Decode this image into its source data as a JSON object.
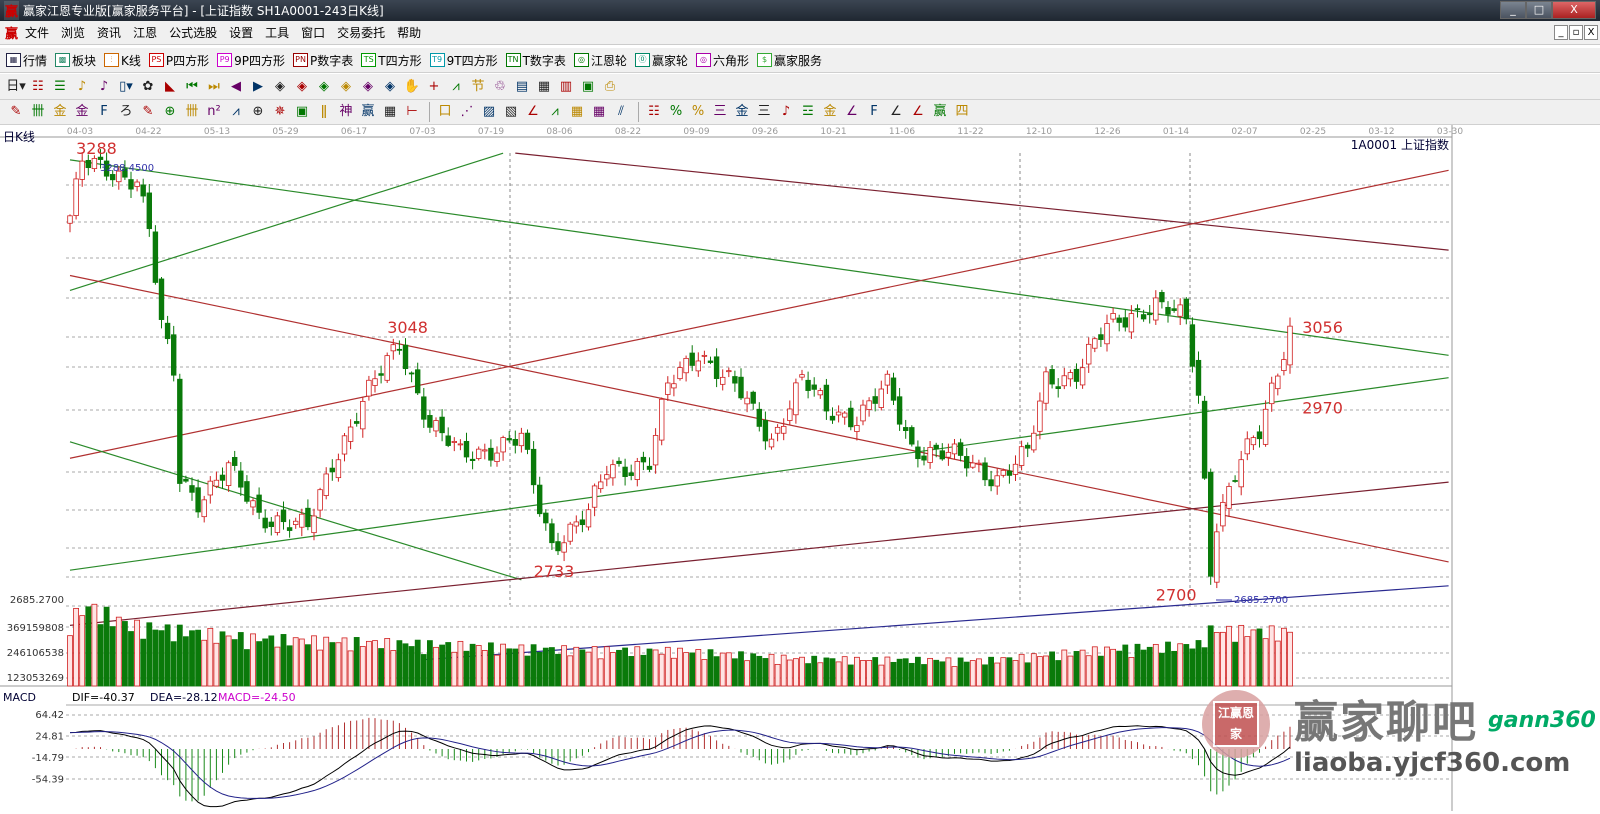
{
  "window": {
    "title": "赢家江恩专业版[赢家服务平台] - [上证指数  SH1A0001-243日K线]",
    "logo": "赢",
    "min": "_",
    "max": "□",
    "close": "X"
  },
  "menu": {
    "logo": "赢",
    "items": [
      "文件",
      "浏览",
      "资讯",
      "江恩",
      "公式选股",
      "设置",
      "工具",
      "窗口",
      "交易委托",
      "帮助"
    ],
    "mdi": [
      "_",
      "▫",
      "X"
    ]
  },
  "toolbar1": [
    {
      "icon": "▦",
      "label": "行情",
      "color": "#224"
    },
    {
      "icon": "▩",
      "label": "板块",
      "color": "#286"
    },
    {
      "icon": "⫶",
      "label": "K线",
      "color": "#c60"
    },
    {
      "icon": "PS",
      "label": "P四方形",
      "color": "#c00"
    },
    {
      "icon": "P9",
      "label": "9P四方形",
      "color": "#c0c"
    },
    {
      "icon": "PN",
      "label": "P数字表",
      "color": "#900"
    },
    {
      "icon": "TS",
      "label": "T四方形",
      "color": "#090"
    },
    {
      "icon": "T9",
      "label": "9T四方形",
      "color": "#09a"
    },
    {
      "icon": "TN",
      "label": "T数字表",
      "color": "#070"
    },
    {
      "icon": "◎",
      "label": "江恩轮",
      "color": "#070"
    },
    {
      "icon": "⓪",
      "label": "赢家轮",
      "color": "#086"
    },
    {
      "icon": "◎",
      "label": "六角形",
      "color": "#a0a"
    },
    {
      "icon": "$",
      "label": "赢家服务",
      "color": "#3a3"
    }
  ],
  "toolbar2": [
    "日▾",
    "☷",
    "☰",
    "♪",
    "♪",
    "▯▾",
    "✿",
    "◣",
    "⏮",
    "⏭",
    "◀",
    "▶",
    "◈",
    "◈",
    "◈",
    "◈",
    "◈",
    "◈",
    "✋",
    "+",
    "⩘",
    "节",
    "♲",
    "▤",
    "▦",
    "▥",
    "▣",
    "⎙"
  ],
  "toolbar3": [
    "✎",
    "卌",
    "金",
    "金",
    "F",
    "ろ",
    "✎",
    "⊕",
    "卌",
    "n²",
    "⩘",
    "⊕",
    "✵",
    "▣",
    "ǁ",
    "神",
    "赢",
    "▦",
    "⊢",
    "|",
    "口",
    "⋰",
    "▨",
    "▧",
    "∠",
    "⩘",
    "▦",
    "▦",
    "⫽",
    "|",
    "☷",
    "%",
    "%",
    "三",
    "金",
    "三",
    "♪",
    "☲",
    "金",
    "∠",
    "F",
    "∠",
    "∠",
    "赢",
    "四"
  ],
  "chart": {
    "period_label": "日K线",
    "symbol": "1A0001  上证指数",
    "dates": [
      "04-03",
      "04-22",
      "05-13",
      "05-29",
      "06-17",
      "07-03",
      "07-19",
      "08-06",
      "08-22",
      "09-09",
      "09-26",
      "10-21",
      "11-06",
      "11-22",
      "12-10",
      "12-26",
      "01-14",
      "02-07",
      "02-25",
      "03-12",
      "03-30"
    ],
    "price_labels": [
      {
        "text": "3288",
        "day": 1,
        "price": 3283
      },
      {
        "text": "3048",
        "day": 52,
        "price": 3043
      },
      {
        "text": "2733",
        "day": 76,
        "price": 2716
      },
      {
        "text": "2700",
        "day": 178,
        "price": 2684
      },
      {
        "text": "3056",
        "day": 202,
        "price": 3043
      },
      {
        "text": "2970",
        "day": 202,
        "price": 2935
      }
    ],
    "high_mark": "3288.4500",
    "low_mark": "2685.2700",
    "axis_low": "2685.2700",
    "close_keyframes": [
      [
        0,
        3200
      ],
      [
        2,
        3270
      ],
      [
        11,
        3250
      ],
      [
        13,
        3180
      ],
      [
        15,
        3050
      ],
      [
        17,
        2990
      ],
      [
        18,
        2850
      ],
      [
        21,
        2820
      ],
      [
        26,
        2860
      ],
      [
        31,
        2800
      ],
      [
        39,
        2780
      ],
      [
        43,
        2870
      ],
      [
        48,
        2950
      ],
      [
        54,
        3030
      ],
      [
        59,
        2920
      ],
      [
        64,
        2880
      ],
      [
        70,
        2890
      ],
      [
        74,
        2900
      ],
      [
        77,
        2810
      ],
      [
        79,
        2760
      ],
      [
        85,
        2800
      ],
      [
        88,
        2860
      ],
      [
        95,
        2870
      ],
      [
        98,
        2970
      ],
      [
        103,
        3020
      ],
      [
        110,
        2960
      ],
      [
        115,
        2900
      ],
      [
        120,
        2980
      ],
      [
        124,
        2940
      ],
      [
        129,
        2930
      ],
      [
        134,
        2970
      ],
      [
        138,
        2890
      ],
      [
        144,
        2880
      ],
      [
        152,
        2850
      ],
      [
        157,
        2880
      ],
      [
        160,
        2980
      ],
      [
        165,
        2990
      ],
      [
        170,
        3050
      ],
      [
        174,
        3070
      ],
      [
        178,
        3080
      ],
      [
        183,
        3060
      ],
      [
        185,
        2960
      ],
      [
        187,
        2730
      ],
      [
        188,
        2790
      ],
      [
        192,
        2870
      ],
      [
        195,
        2910
      ],
      [
        197,
        2970
      ],
      [
        200,
        3050
      ]
    ],
    "volume_keyframes_millions": [
      [
        0,
        420
      ],
      [
        3,
        500
      ],
      [
        10,
        380
      ],
      [
        30,
        300
      ],
      [
        60,
        260
      ],
      [
        80,
        230
      ],
      [
        100,
        220
      ],
      [
        120,
        170
      ],
      [
        150,
        160
      ],
      [
        170,
        230
      ],
      [
        185,
        260
      ],
      [
        187,
        350
      ],
      [
        200,
        340
      ]
    ],
    "volume_axis": [
      "369159808",
      "246106538",
      "123053269"
    ],
    "trendlines": [
      {
        "from": [
          0,
          3100
        ],
        "to": [
          71,
          3284
        ],
        "color": "#2a8a2a"
      },
      {
        "from": [
          73,
          3284
        ],
        "to": [
          226,
          3154
        ],
        "color": "#7a2030"
      },
      {
        "from": [
          0,
          3275
        ],
        "to": [
          226,
          3013
        ],
        "color": "#2a8a2a"
      },
      {
        "from": [
          0,
          2875
        ],
        "to": [
          226,
          3261
        ],
        "color": "#b03030"
      },
      {
        "from": [
          0,
          3120
        ],
        "to": [
          226,
          2736
        ],
        "color": "#b03030"
      },
      {
        "from": [
          0,
          2897
        ],
        "to": [
          74,
          2712
        ],
        "color": "#2a8a2a"
      },
      {
        "from": [
          0,
          2725
        ],
        "to": [
          226,
          2983
        ],
        "color": "#2a8a2a"
      },
      {
        "from": [
          0,
          2651
        ],
        "to": [
          226,
          2843
        ],
        "color": "#7a2030"
      },
      {
        "from": [
          58,
          2605
        ],
        "to": [
          226,
          2704
        ],
        "color": "#2a2a90"
      }
    ],
    "macd": {
      "title": "MACD",
      "dif": "DIF=-40.37",
      "dea": "DEA=-28.12",
      "macd": "MACD=-24.50",
      "axis": [
        "64.42",
        "24.81",
        "-14.79",
        "-54.39"
      ]
    },
    "colors": {
      "up": "#d02020",
      "down": "#0a7a0a",
      "up_fill": "#ffe4e4"
    }
  },
  "watermark": {
    "seal": "江赢恩家",
    "title": "赢家聊吧",
    "url": "liaoba.yjcf360.com",
    "logo": "gann360"
  }
}
